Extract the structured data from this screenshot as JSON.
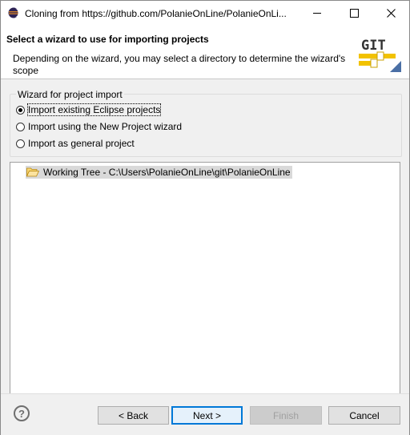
{
  "window": {
    "title": "Cloning from https://github.com/PolanieOnLine/PolanieOnLi...",
    "icons": {
      "app": "eclipse-icon",
      "minimize": "minimize-icon",
      "maximize": "maximize-icon",
      "close": "close-icon"
    }
  },
  "banner": {
    "title": "Select a wizard to use for importing projects",
    "description": "Depending on the wizard, you may select a directory to determine the wizard's scope",
    "logo_text": "GIT"
  },
  "wizard_group": {
    "label": "Wizard for project import",
    "options": [
      {
        "label": "Import existing Eclipse projects",
        "checked": true
      },
      {
        "label": "Import using the New Project wizard",
        "checked": false
      },
      {
        "label": "Import as general project",
        "checked": false
      }
    ]
  },
  "tree": {
    "items": [
      {
        "icon": "folder-open-icon",
        "label": "Working Tree - C:\\Users\\PolanieOnLine\\git\\PolanieOnLine"
      }
    ]
  },
  "buttons": {
    "help": "?",
    "back": "< Back",
    "next": "Next >",
    "finish": "Finish",
    "cancel": "Cancel"
  },
  "colors": {
    "accent": "#0078d7",
    "dialog_bg": "#f0f0f0",
    "selection": "#d9d9d9"
  }
}
